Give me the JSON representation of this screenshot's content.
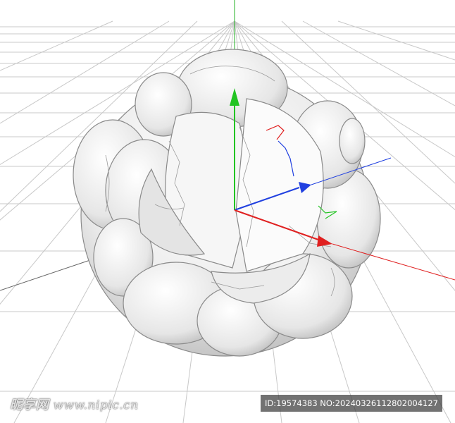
{
  "viewport": {
    "background": "#ffffff",
    "grid_color": "#c8c8c8",
    "object": "rock-cluster-mesh",
    "axes": {
      "y_color": "#22c422",
      "x_color": "#e02020",
      "z_color": "#2040e0"
    }
  },
  "watermark": {
    "brand": "昵享网",
    "site": "www.nipic.cn"
  },
  "badge": {
    "text": "ID:19574383 NO:20240326112802004127"
  }
}
